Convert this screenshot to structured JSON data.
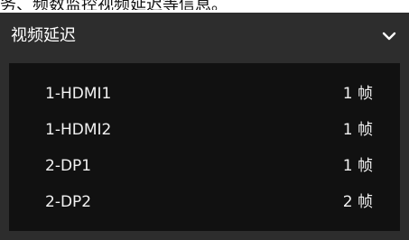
{
  "header_fragment": "务、频数监控视频延迟等信息。",
  "panel": {
    "title": "视频延迟",
    "toggle_icon": "chevron-down-icon"
  },
  "items": [
    {
      "label": "1-HDMI1",
      "value": "1 帧"
    },
    {
      "label": "1-HDMI2",
      "value": "1 帧"
    },
    {
      "label": "2-DP1",
      "value": "1 帧"
    },
    {
      "label": "2-DP2",
      "value": "2 帧"
    }
  ],
  "colors": {
    "panel_bg": "#2d2d2d",
    "list_bg": "#111111",
    "text": "#f2f2f2"
  }
}
